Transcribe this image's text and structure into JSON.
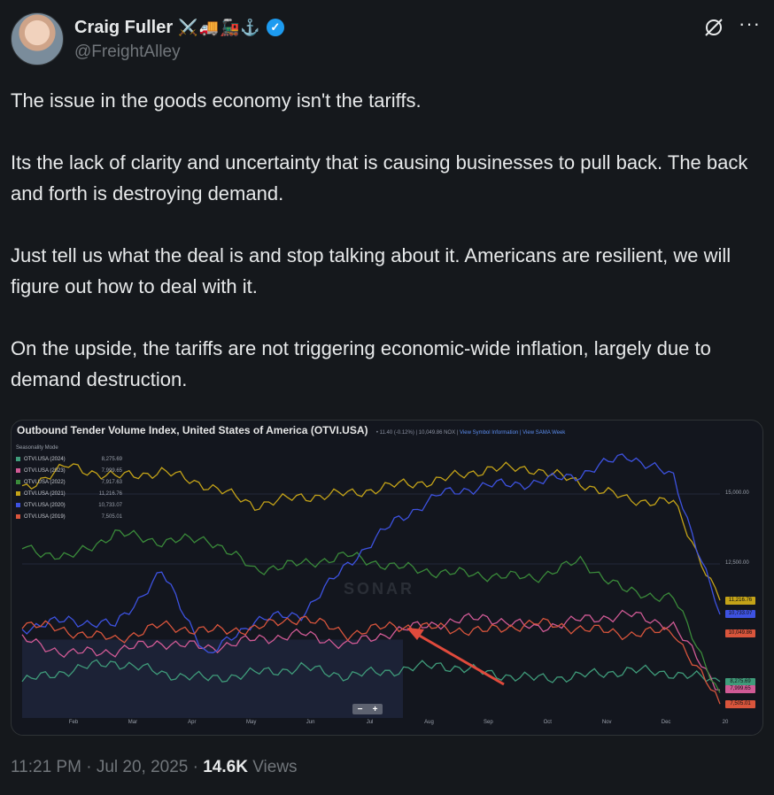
{
  "author": {
    "display_name": "Craig Fuller",
    "name_emojis": "⚔️🚚🚂⚓",
    "handle": "@FreightAlley",
    "avatar_icon": "avatar-photo"
  },
  "tweet": {
    "paragraphs": [
      "The issue in the goods economy isn't the tariffs.",
      "Its the lack of clarity and uncertainty that is causing businesses to pull back. The back and forth is destroying demand.",
      "Just tell us what the deal is and stop talking about it. Americans are resilient, we will figure out how to deal with it.",
      "On the upside, the tariffs are not triggering economic-wide inflation, largely due to demand destruction."
    ]
  },
  "meta": {
    "time": "11:21 PM",
    "sep": "·",
    "date": "Jul 20, 2025",
    "views_count": "14.6K",
    "views_label": "Views"
  },
  "chart_data": {
    "type": "line",
    "title": "Outbound Tender Volume Index, United States of America (OTVI.USA)",
    "subinfo": "• 11.40 (-0.12%) | 10,049.86 NOX |",
    "subinfo_links": [
      "View Symbol Information",
      "| View SAMA Week"
    ],
    "legend_mode": "Seasonality Mode",
    "x_labels": [
      "Feb",
      "Mar",
      "Apr",
      "May",
      "Jun",
      "Jul",
      "Aug",
      "Sep",
      "Oct",
      "Nov",
      "Dec",
      "20"
    ],
    "y_labels": [
      "15,000.00",
      "12,500.00"
    ],
    "ylim": [
      7000,
      16800
    ],
    "watermark": "SONAR",
    "series": [
      {
        "name": "OTVI.USA (2024)",
        "value_label": "8,275.69",
        "color": "#3f9b7a",
        "values": [
          8300,
          8700,
          9000,
          8600,
          8400,
          8600,
          8800,
          8500,
          8700,
          8900,
          8600,
          8400,
          8500,
          8700,
          8600,
          8300
        ]
      },
      {
        "name": "OTVI.USA (2023)",
        "value_label": "7,999.65",
        "color": "#d05a95",
        "values": [
          9800,
          9300,
          9400,
          9700,
          9500,
          9800,
          10000,
          9600,
          10100,
          10400,
          10600,
          10200,
          10500,
          10700,
          10300,
          8000
        ]
      },
      {
        "name": "OTVI.USA (2022)",
        "value_label": "7,917.63",
        "color": "#3a8a3a",
        "values": [
          13100,
          12700,
          13600,
          13300,
          13400,
          12300,
          12500,
          12800,
          12400,
          12200,
          12100,
          12000,
          12600,
          11500,
          11300,
          7900
        ]
      },
      {
        "name": "OTVI.USA (2021)",
        "value_label": "11,216.76",
        "color": "#c4a318",
        "values": [
          15200,
          16000,
          15600,
          15800,
          15300,
          14600,
          14900,
          15000,
          15300,
          15500,
          15900,
          15900,
          15400,
          14800,
          14700,
          11200
        ]
      },
      {
        "name": "OTVI.USA (2020)",
        "value_label": "10,733.07",
        "color": "#3d52e0",
        "values": [
          10200,
          10500,
          10300,
          12200,
          9200,
          10500,
          10700,
          12500,
          14000,
          15000,
          15300,
          15400,
          15700,
          16400,
          15600,
          10700
        ]
      },
      {
        "name": "OTVI.USA (2019)",
        "value_label": "7,505.01",
        "color": "#d9553c",
        "values": [
          10400,
          10100,
          9800,
          10300,
          10100,
          10200,
          10600,
          10000,
          10300,
          10200,
          10100,
          10400,
          10200,
          10000,
          10100,
          7500
        ]
      }
    ],
    "price_tags": [
      {
        "label": "11,216.76",
        "color": "#c4a318",
        "value": 11220
      },
      {
        "label": "10,733.07",
        "color": "#3d52e0",
        "value": 10740
      },
      {
        "label": "10,049.86",
        "color": "#d9553c",
        "value": 10050
      },
      {
        "label": "8,275.69",
        "color": "#3f9b7a",
        "value": 8290
      },
      {
        "label": "7,999.65",
        "color": "#d05a95",
        "value": 8030
      },
      {
        "label": "7,505.01",
        "color": "#d9553c",
        "value": 7520
      }
    ],
    "zoom": {
      "minus": "−",
      "plus": "+"
    }
  }
}
